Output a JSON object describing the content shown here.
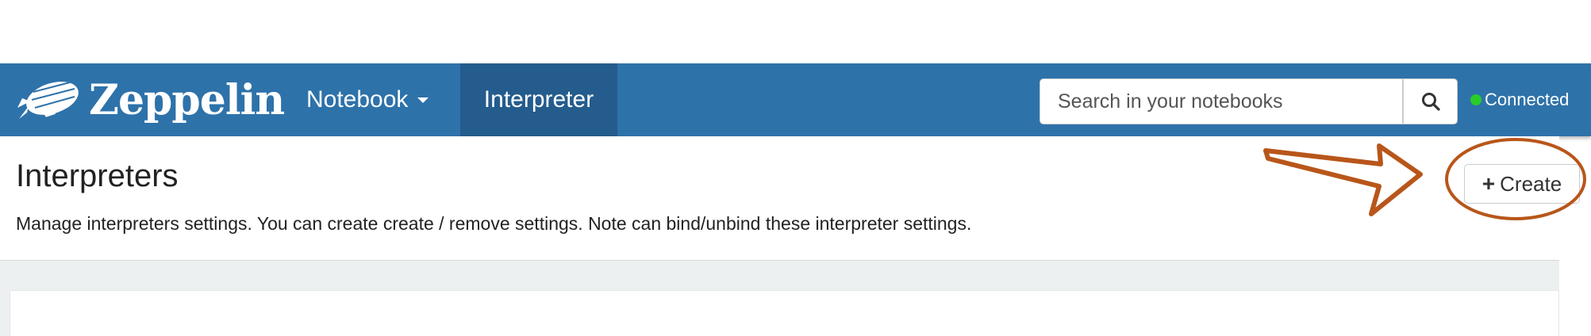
{
  "navbar": {
    "brand": "Zeppelin",
    "notebook_label": "Notebook",
    "interpreter_label": "Interpreter",
    "search": {
      "placeholder": "Search in your notebooks"
    },
    "status": "Connected"
  },
  "page": {
    "title": "Interpreters",
    "description": "Manage interpreters settings. You can create create / remove settings. Note can bind/unbind these interpreter settings.",
    "create_label": "Create"
  },
  "colors": {
    "navbar": "#2e72aa",
    "nav_active": "#245c8d",
    "status_dot": "#29cc29",
    "annotation": "#b8561a",
    "background_band": "#ecf0f1"
  },
  "icons": [
    "zeppelin-logo-icon",
    "caret-down-icon",
    "search-icon",
    "plus-icon",
    "arrow-annotation-icon",
    "circle-annotation-icon"
  ]
}
